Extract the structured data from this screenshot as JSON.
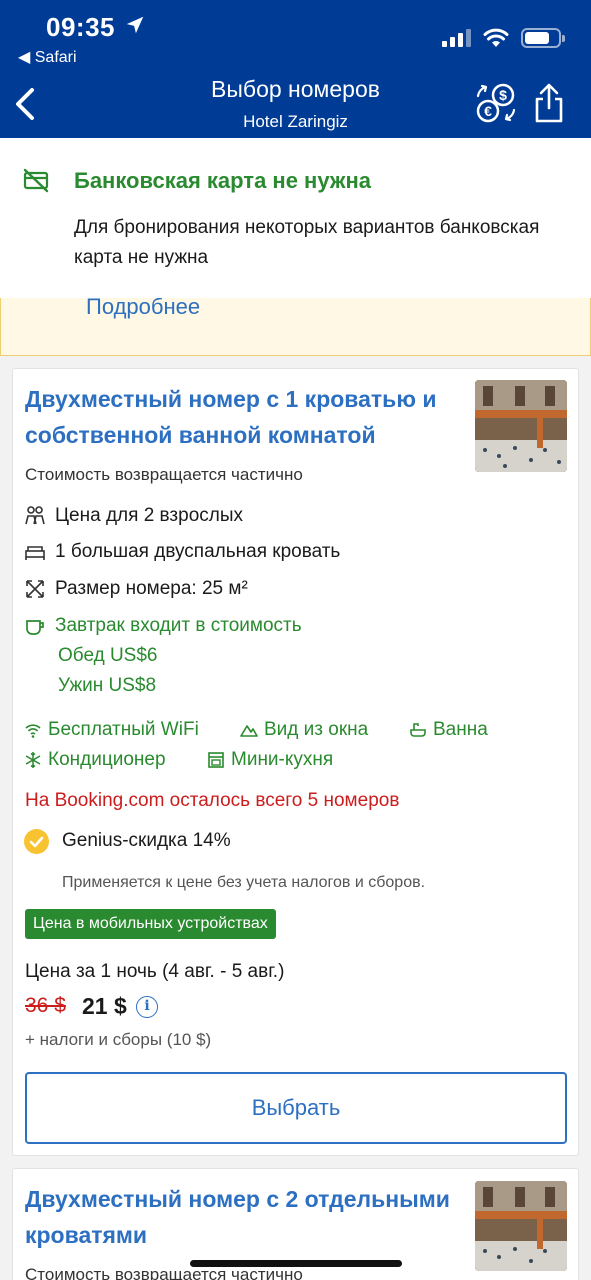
{
  "status_bar": {
    "time": "09:35",
    "back_app": "◀ Safari",
    "battery_level": 0.75
  },
  "nav": {
    "title": "Выбор номеров",
    "subtitle": "Hotel Zaringiz"
  },
  "banner": {
    "title": "Банковская карта не нужна",
    "text": "Для бронирования некоторых вариантов банковская карта не нужна",
    "more_link": "Подробнее"
  },
  "room1": {
    "title": "Двухместный номер с 1 кроватью и собственной ванной комнатой",
    "refund": "Стоимость возвращается частично",
    "features": {
      "guests": "Цена для 2 взрослых",
      "bed": "1 большая двуспальная кровать",
      "size": "Размер номера: 25 м²"
    },
    "meals": {
      "breakfast": "Завтрак входит в стоимость",
      "lunch": "Обед US$6",
      "dinner": "Ужин US$8"
    },
    "amenities": {
      "wifi": "Бесплатный WiFi",
      "view": "Вид из окна",
      "bath": "Ванна",
      "ac": "Кондиционер",
      "kitchen": "Мини-кухня"
    },
    "rooms_left": "На Booking.com осталось всего 5 номеров",
    "genius": "Genius-скидка 14%",
    "genius_note": "Применяется к цене без учета налогов и сборов.",
    "mobile_badge": "Цена в мобильных устройствах",
    "price_label": "Цена за 1 ночь (4 авг. - 5 авг.)",
    "old_price": "36 $",
    "new_price": "21 $",
    "taxes": "+ налоги и сборы (10 $)",
    "select_button": "Выбрать"
  },
  "room2": {
    "title": "Двухместный номер с 2 отдельными кроватями",
    "refund": "Стоимость возвращается частично"
  },
  "colors": {
    "brand_blue": "#003b95",
    "link_blue": "#2d6fc1",
    "green": "#2a8a2f",
    "red": "#cc1d1d",
    "genius_yellow": "#f7c331"
  }
}
